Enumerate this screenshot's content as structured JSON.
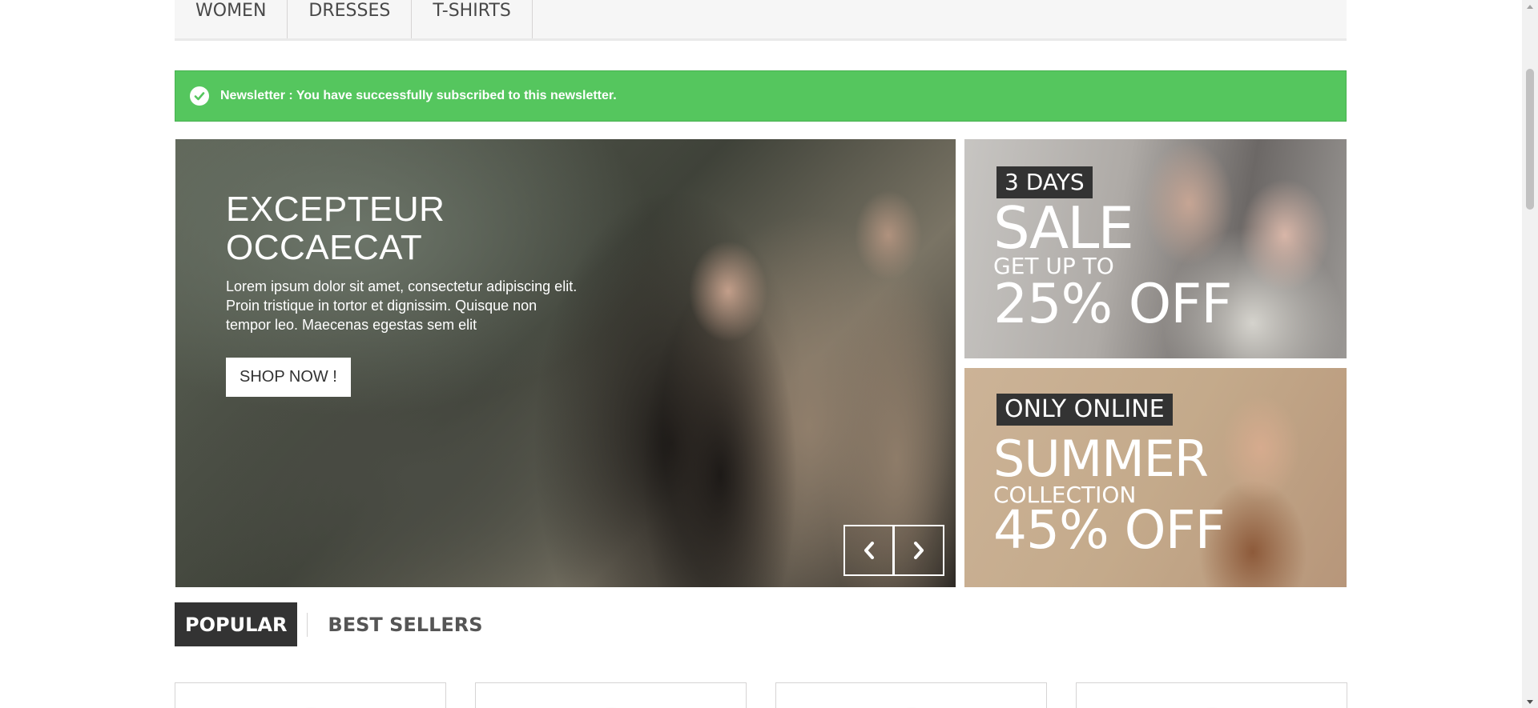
{
  "nav": {
    "items": [
      "WOMEN",
      "DRESSES",
      "T-SHIRTS"
    ]
  },
  "alert": {
    "message": "Newsletter : You have successfully subscribed to this newsletter.",
    "color": "#55c65e"
  },
  "slider": {
    "title_line1": "EXCEPTEUR",
    "title_line2": "OCCAECAT",
    "text": "Lorem ipsum dolor sit amet, consectetur adipiscing elit. Proin tristique in tortor et dignissim. Quisque non tempor leo. Maecenas egestas sem elit",
    "button_label": "SHOP NOW !",
    "prev_icon": "chevron-left-icon",
    "next_icon": "chevron-right-icon"
  },
  "banners": [
    {
      "tag": "3 DAYS",
      "line1": "SALE",
      "line2": "GET UP TO",
      "line3": "25% OFF"
    },
    {
      "tag": "ONLY ONLINE",
      "line1": "SUMMER",
      "line2": "COLLECTION",
      "line3": "45% OFF"
    }
  ],
  "tabs": {
    "active": "POPULAR",
    "inactive": "BEST SELLERS"
  }
}
